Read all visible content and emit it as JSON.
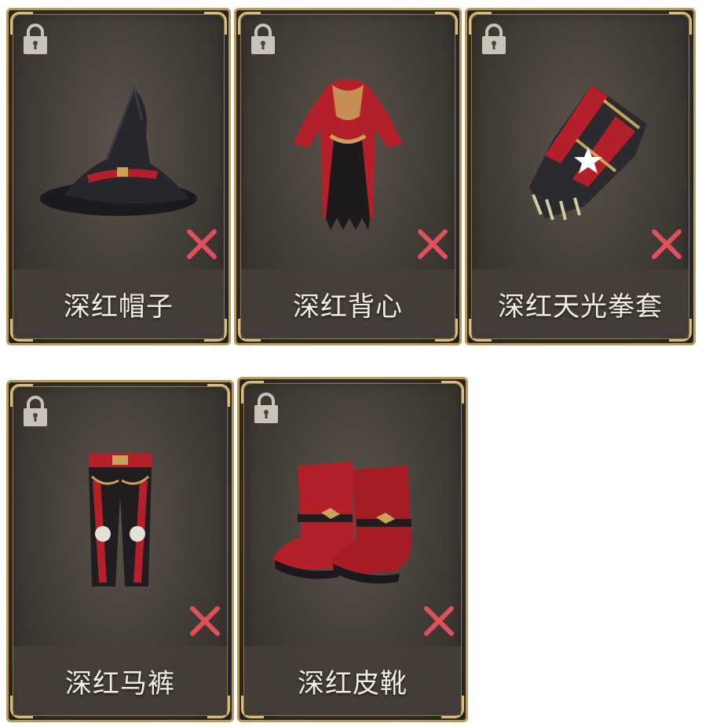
{
  "items": [
    {
      "name": "深红帽子",
      "locked": true,
      "removable": true,
      "icon": "witch-hat-icon"
    },
    {
      "name": "深红背心",
      "locked": true,
      "removable": true,
      "icon": "robe-icon"
    },
    {
      "name": "深红天光拳套",
      "locked": true,
      "removable": true,
      "icon": "gauntlet-icon"
    },
    {
      "name": "深红马裤",
      "locked": true,
      "removable": true,
      "icon": "pants-icon"
    },
    {
      "name": "深红皮靴",
      "locked": true,
      "removable": true,
      "icon": "boots-icon"
    }
  ],
  "colors": {
    "accent_gold": "#b99a5a",
    "remove_red": "#e0505a",
    "item_red": "#b3202a"
  }
}
